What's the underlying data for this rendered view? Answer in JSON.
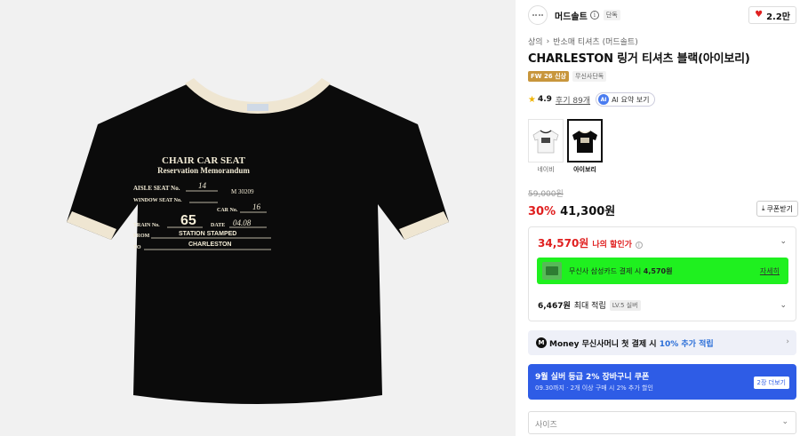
{
  "product_image": {
    "shirt_lines": [
      "CHAIR CAR SEAT",
      "Reservation Memorandum",
      "AISLE SEAT No.",
      "14",
      "M 30209",
      "WINDOW SEAT No.",
      "CAR No.",
      "16",
      "TRAIN No.",
      "65",
      "DATE",
      "04.08",
      "FROM",
      "STATION STAMPED",
      "TO",
      "CHARLESTON"
    ]
  },
  "brand": {
    "name": "머드솔트",
    "info_icon": "i",
    "exclusive": "단독",
    "likes": "2.2만"
  },
  "breadcrumb": [
    "상의",
    "반소매 티셔츠 (머드솔트)"
  ],
  "title": "CHARLESTON 링거 티셔츠 블랙(아이보리)",
  "tags": {
    "season": "FW 26 신상",
    "exclusive": "무신사단독"
  },
  "rating": {
    "score": "4.9",
    "reviews": "후기 89개",
    "ai_badge": "AI",
    "ai_label": "AI 요약 보기"
  },
  "variants": [
    {
      "label": "네이비",
      "selected": false
    },
    {
      "label": "아이보리",
      "selected": true
    }
  ],
  "pricing": {
    "original": "59,000원",
    "discount": "30%",
    "price": "41,300원",
    "coupon_btn": "쿠폰받기"
  },
  "benefits": {
    "my_price": "34,570원",
    "my_price_label": "나의 할인가",
    "card_text_pre": "무신사 삼성카드 결제 시",
    "card_text_amt": "4,570원",
    "card_detail": "자세히",
    "points": "6,467원",
    "points_label": "최대 적립",
    "level": "LV.5 실버"
  },
  "money_banner": {
    "icon": "M",
    "text_pre": "Money 무신사머니 첫 결제 시",
    "text_pct": "10% 추가 적립"
  },
  "coupon_banner": {
    "title": "9월 실버 등급 2% 장바구니 쿠폰",
    "subtitle": "09.30까지 · 2개 이상 구매 시 2% 추가 할인",
    "button": "2장 더보기"
  },
  "size_select": {
    "placeholder": "사이즈"
  },
  "colors": {
    "shirt": "#0b0b0b",
    "trim": "#efe6d2",
    "print": "#f3ecd6",
    "accent_red": "#e02020",
    "card_green": "#1ff01f",
    "coupon_blue": "#2e5ce6"
  }
}
